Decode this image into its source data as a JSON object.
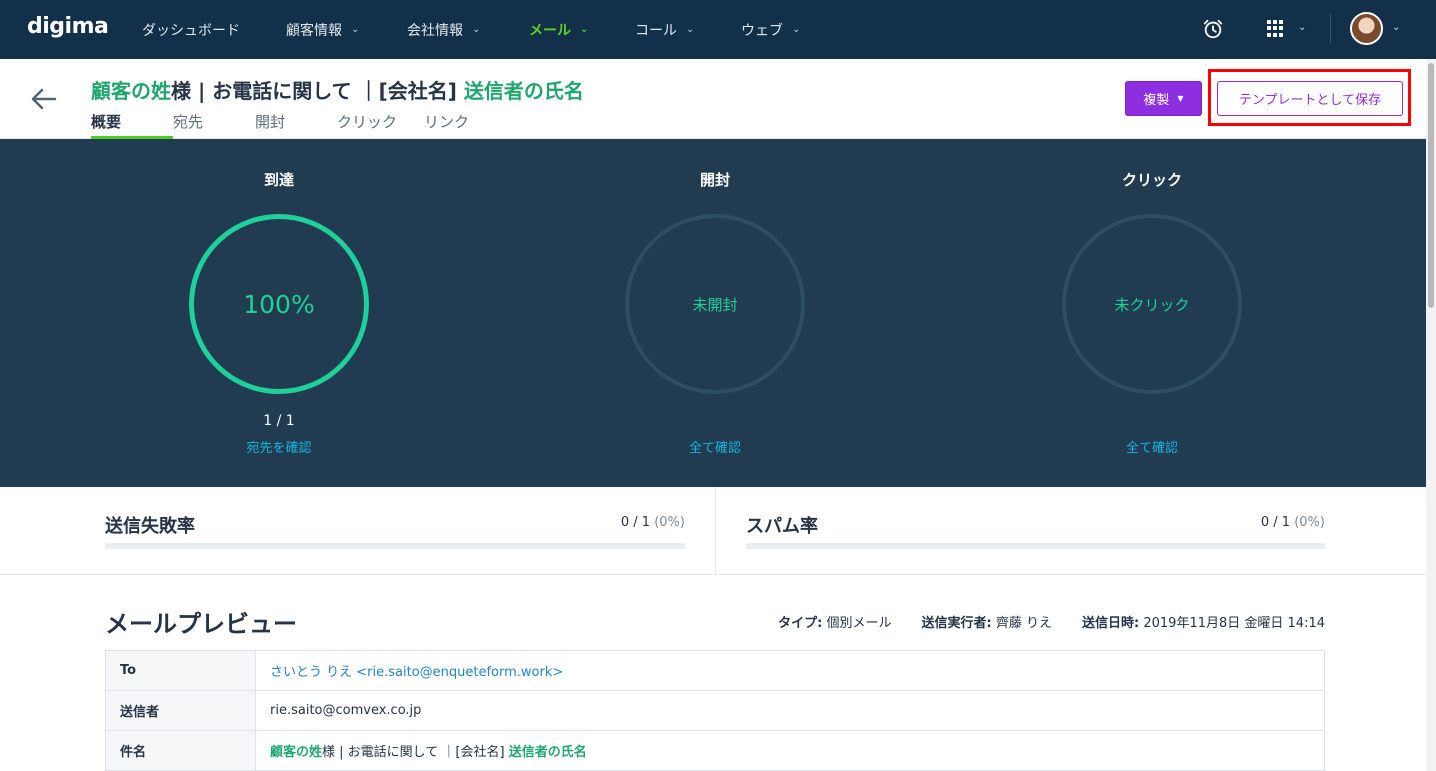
{
  "app": {
    "logo": "digima",
    "brand_color": "#1fa56e",
    "accent_color": "#8d2fe0",
    "active_nav_color": "#5ed41f"
  },
  "nav": {
    "items": [
      {
        "label": "ダッシュボード",
        "has_menu": false,
        "active": false
      },
      {
        "label": "顧客情報",
        "has_menu": true,
        "active": false
      },
      {
        "label": "会社情報",
        "has_menu": true,
        "active": false
      },
      {
        "label": "メール",
        "has_menu": true,
        "active": true
      },
      {
        "label": "コール",
        "has_menu": true,
        "active": false
      },
      {
        "label": "ウェブ",
        "has_menu": true,
        "active": false
      }
    ],
    "icons": [
      "alarm-clock-icon",
      "apps-grid-icon",
      "user-avatar"
    ]
  },
  "header": {
    "title_parts": {
      "p1": "顧客の姓",
      "p2": "様 | お電話に関して ｜[会社名] ",
      "p3": "送信者の氏名"
    },
    "tabs": [
      "概要",
      "宛先",
      "開封",
      "クリック",
      "リンク"
    ],
    "active_tab": "概要",
    "duplicate_label": "複製",
    "save_template_label": "テンプレートとして保存"
  },
  "stats": [
    {
      "title": "到達",
      "center": "100%",
      "percent": 100,
      "count": "1 / 1",
      "link": "宛先を確認"
    },
    {
      "title": "開封",
      "center": "未開封",
      "percent": 0,
      "count": "",
      "link": "全て確認"
    },
    {
      "title": "クリック",
      "center": "未クリック",
      "percent": 0,
      "count": "",
      "link": "全て確認"
    }
  ],
  "rates": {
    "failure": {
      "title": "送信失敗率",
      "value": "0 / 1",
      "pct": "(0%)",
      "percent": 0
    },
    "spam": {
      "title": "スパム率",
      "value": "0 / 1",
      "pct": "(0%)",
      "percent": 0
    }
  },
  "preview": {
    "title": "メールプレビュー",
    "meta": {
      "type_label": "タイプ:",
      "type_value": "個別メール",
      "sender_label": "送信実行者:",
      "sender_value": "齊藤 りえ",
      "date_label": "送信日時:",
      "date_value": "2019年11月8日 金曜日 14:14"
    },
    "rows": {
      "to_label": "To",
      "to_value": "さいとう りえ <rie.saito@enqueteform.work>",
      "from_label": "送信者",
      "from_value": "rie.saito@comvex.co.jp",
      "subject_label": "件名",
      "subject_p1": "顧客の姓",
      "subject_p2": "様 | お電話に関して ｜[会社名] ",
      "subject_p3": "送信者の氏名"
    }
  }
}
